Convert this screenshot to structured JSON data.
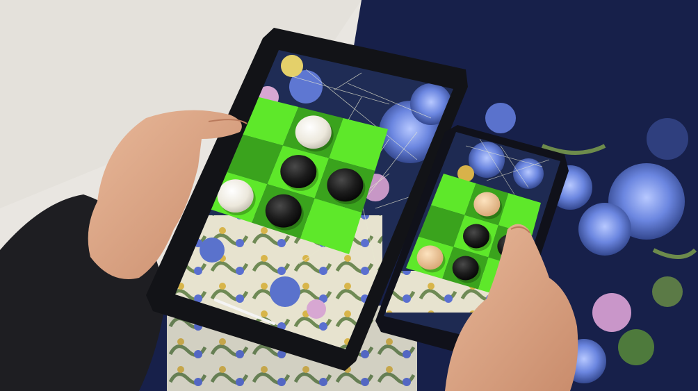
{
  "scene": {
    "description_tags": [
      "photo",
      "ar-game",
      "tablet",
      "phone",
      "board-game"
    ],
    "colors": {
      "wall": "#e9e6e1",
      "blanket_dark": "#1a2347",
      "board_light": "#5ee82a",
      "board_dark": "#3aa31d",
      "stone_black": "#1c1c1c",
      "stone_white": "#f2efe6",
      "stone_tan": "#e9c79a",
      "device_frame": "#121317"
    }
  },
  "tablet": {
    "status_line_1": "",
    "status_line_2": "",
    "board": {
      "rows": 3,
      "cols": 3,
      "cells": [
        [
          "light",
          "dark",
          "light"
        ],
        [
          "dark",
          "light",
          "dark"
        ],
        [
          "light",
          "dark",
          "light"
        ]
      ],
      "stones": [
        {
          "row": 0,
          "col": 1,
          "color": "white"
        },
        {
          "row": 1,
          "col": 1,
          "color": "black"
        },
        {
          "row": 1,
          "col": 2,
          "color": "black"
        },
        {
          "row": 2,
          "col": 0,
          "color": "white"
        },
        {
          "row": 2,
          "col": 1,
          "color": "black"
        }
      ]
    }
  },
  "phone": {
    "board": {
      "rows": 3,
      "cols": 3,
      "stones": [
        {
          "row": 0,
          "col": 1,
          "color": "tan"
        },
        {
          "row": 1,
          "col": 1,
          "color": "black"
        },
        {
          "row": 1,
          "col": 2,
          "color": "black"
        },
        {
          "row": 2,
          "col": 0,
          "color": "tan"
        },
        {
          "row": 2,
          "col": 1,
          "color": "black"
        }
      ]
    }
  }
}
